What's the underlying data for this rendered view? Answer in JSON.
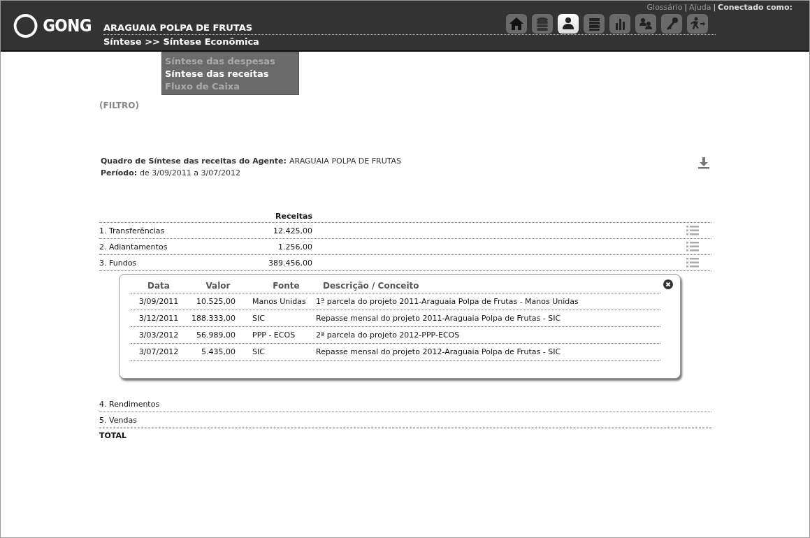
{
  "header": {
    "logo": "GONG",
    "agent": "ARAGUAIA POLPA DE FRUTAS",
    "breadcrumb": "Síntese >> Síntese Econômica",
    "links": [
      {
        "label": "Glossário",
        "separator": "|"
      },
      {
        "label": "Ajuda",
        "separator": "|"
      }
    ],
    "user_label": "Conectado como:",
    "toolbar": [
      {
        "selected": false
      },
      {
        "selected": false
      },
      {
        "selected": true
      },
      {
        "selected": false
      },
      {
        "selected": false
      },
      {
        "selected": false
      },
      {
        "selected": false
      },
      {
        "selected": false
      }
    ]
  },
  "submenu": [
    {
      "label": "Síntese das despesas",
      "selected": false
    },
    {
      "label": "Síntese das receitas",
      "selected": true
    },
    {
      "label": "Fluxo de Caixa",
      "selected": false
    }
  ],
  "filter": "(FILTRO)",
  "summary": {
    "title_label": "Quadro de Síntese das receitas do Agente:",
    "title_value": "ARAGUAIA POLPA DE FRUTAS",
    "period_label": "Período:",
    "period_value": "de 3/09/2011 a 3/07/2012"
  },
  "table": {
    "column": "Receitas",
    "rows": [
      {
        "label": "1. Transferências",
        "value": "12.425,00",
        "has_details": true
      },
      {
        "label": "2. Adiantamentos",
        "value": "1.256,00",
        "has_details": true
      },
      {
        "label": "3. Fundos",
        "value": "389.456,00",
        "has_details": true,
        "details": {
          "columns": [
            "Data",
            "Valor",
            "Fonte",
            "Descrição / Conceito"
          ],
          "rows": [
            [
              "3/09/2011",
              "10.525,00",
              "Manos Unidas",
              "1ª parcela do projeto 2011-Araguaia Polpa de Frutas - Manos Unidas"
            ],
            [
              "3/12/2011",
              "188.333,00",
              "SIC",
              "Repasse mensal do projeto 2011-Araguaia Polpa de Frutas - SIC"
            ],
            [
              "3/03/2012",
              "56.989,00",
              "PPP - ECOS",
              "2ª parcela do projeto 2012-PPP-ECOS"
            ],
            [
              "3/07/2012",
              "5.435,00",
              "SIC",
              "Repasse mensal do projeto 2012-Araguaia Polpa de Frutas - SIC"
            ]
          ]
        }
      },
      {
        "label": "4. Rendimentos",
        "has_details": false
      },
      {
        "label": "5. Vendas",
        "has_details": false
      }
    ],
    "total": "TOTAL"
  }
}
